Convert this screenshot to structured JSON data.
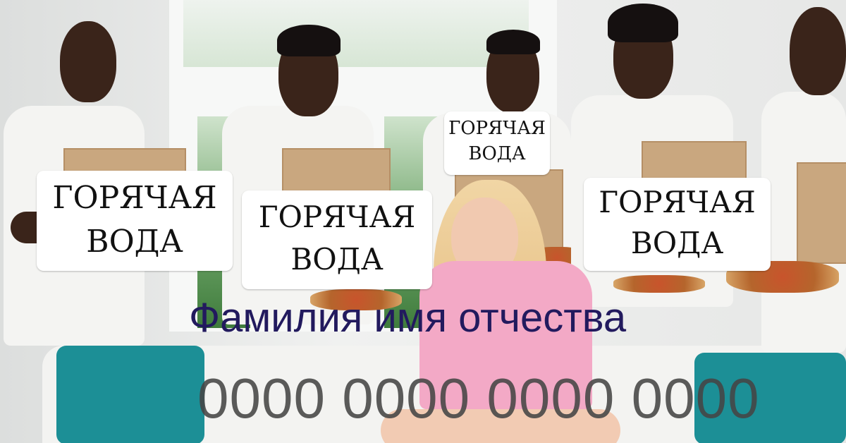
{
  "labels": [
    {
      "line1": "ГОРЯЧАЯ",
      "line2": "ВОДА"
    },
    {
      "line1": "ГОРЯЧАЯ",
      "line2": "ВОДА"
    },
    {
      "line1": "ГОРЯЧАЯ",
      "line2": "ВОДА"
    },
    {
      "line1": "ГОРЯЧАЯ",
      "line2": "ВОДА"
    }
  ],
  "caption": {
    "name": "Фамилия имя отчества",
    "number": "0000 0000 0000 0000"
  },
  "colors": {
    "caption_name": "#221a5e",
    "caption_number": "#454545",
    "cushion": "#1c8f96",
    "top": "#f3a9c6"
  }
}
